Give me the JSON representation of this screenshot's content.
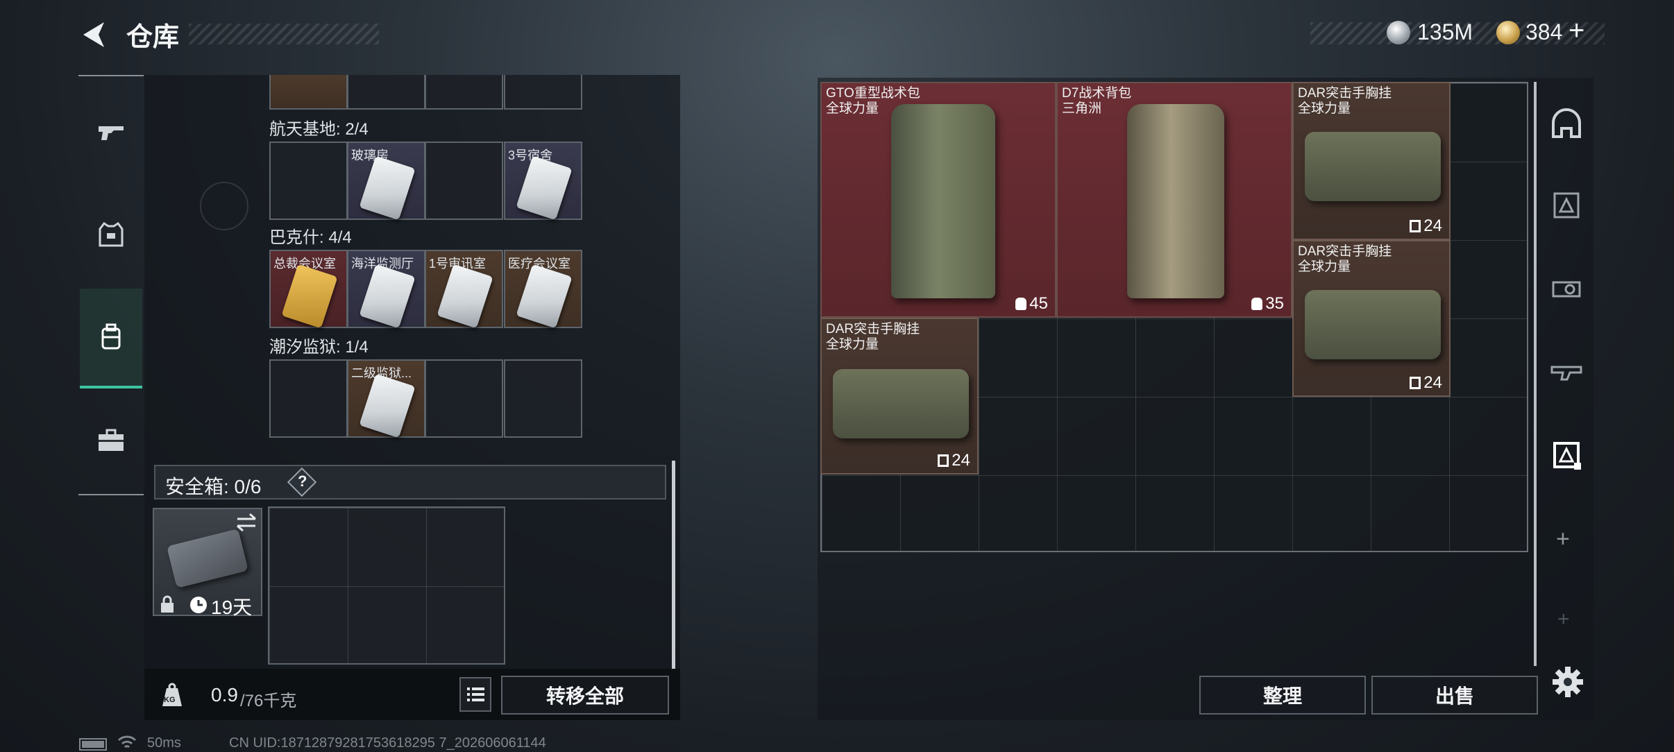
{
  "header": {
    "title": "仓库",
    "currency1": "135M",
    "currency2": "384",
    "plus": "+"
  },
  "left_panel": {
    "sections": [
      {
        "label": "航天基地: 2/4",
        "cards": [
          "",
          "玻璃房",
          "",
          "3号宿舍"
        ]
      },
      {
        "label": "巴克什: 4/4",
        "cards": [
          "总裁会议室",
          "海洋监测厅",
          "1号审讯室",
          "医疗会议室"
        ]
      },
      {
        "label": "潮汐监狱: 1/4",
        "cards": [
          "",
          "二级监狱...",
          "",
          ""
        ]
      }
    ],
    "safe_box": {
      "label": "安全箱: 0/6",
      "help": "?",
      "days": "19天"
    },
    "weight": {
      "value": "0.9",
      "max": "/76千克",
      "icon_label": "KG"
    },
    "transfer_all": "转移全部"
  },
  "inventory": {
    "items": [
      {
        "name": "GTO重型战术包",
        "sub": "全球力量",
        "capacity": "45"
      },
      {
        "name": "D7战术背包",
        "sub": "三角洲",
        "capacity": "35"
      },
      {
        "name": "DAR突击手胸挂",
        "sub": "全球力量",
        "capacity": "24"
      },
      {
        "name": "DAR突击手胸挂",
        "sub": "全球力量",
        "capacity": "24"
      },
      {
        "name": "DAR突击手胸挂",
        "sub": "全球力量",
        "capacity": "24"
      }
    ],
    "sort_button": "整理",
    "sell_button": "出售"
  },
  "right_nav": {
    "add1": "+",
    "add2": "+"
  },
  "status": {
    "ping": "50ms",
    "uid": "CN UID:18712879281753618295 7_202606061144"
  },
  "colors": {
    "accent": "#3cc6a0",
    "backpack_bg": "#5f2a2f",
    "vest_bg": "#43332b"
  }
}
